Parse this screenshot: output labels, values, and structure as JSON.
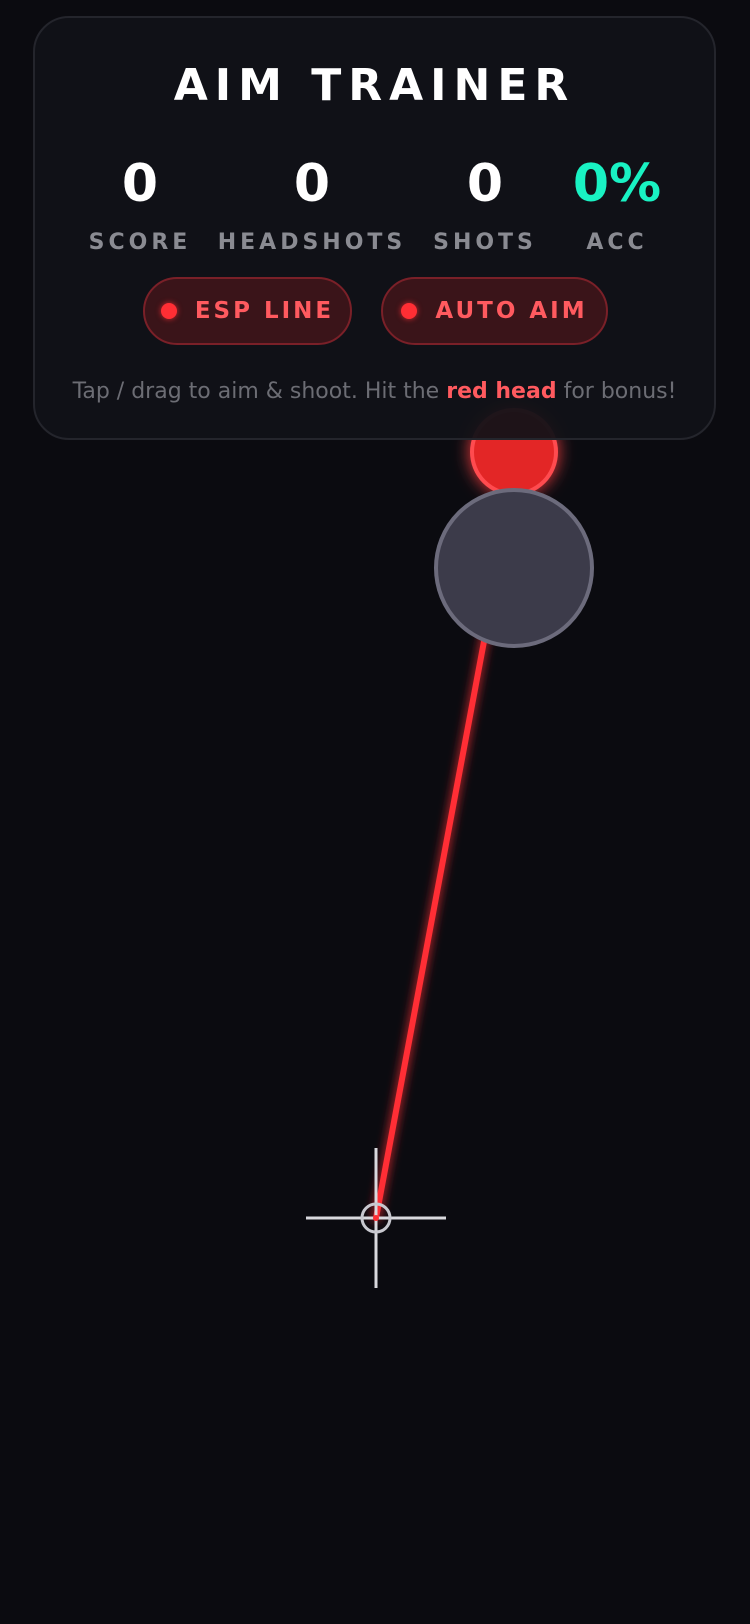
{
  "hud": {
    "title": "AIM TRAINER",
    "stats": {
      "score": {
        "value": "0",
        "label": "SCORE"
      },
      "headshots": {
        "value": "0",
        "label": "HEADSHOTS"
      },
      "shots": {
        "value": "0",
        "label": "SHOTS"
      },
      "accuracy": {
        "value": "0%",
        "label": "ACC"
      }
    },
    "toggles": {
      "esp_line": {
        "label": "ESP LINE",
        "enabled": true
      },
      "auto_aim": {
        "label": "AUTO AIM",
        "enabled": true
      }
    },
    "hint": {
      "before": "Tap / drag to aim & shoot. Hit the",
      "highlight": "red head",
      "after": "for bonus!"
    }
  },
  "colors": {
    "background": "#0b0b10",
    "accent_red": "#ff2e34",
    "accuracy_green": "#19f2c3",
    "target_body": "#3c3b4a",
    "target_head": "#e32828",
    "crosshair": "#d9d9de"
  },
  "icons": {
    "toggle_indicator": "red-dot-icon",
    "crosshair": "crosshair-icon"
  }
}
